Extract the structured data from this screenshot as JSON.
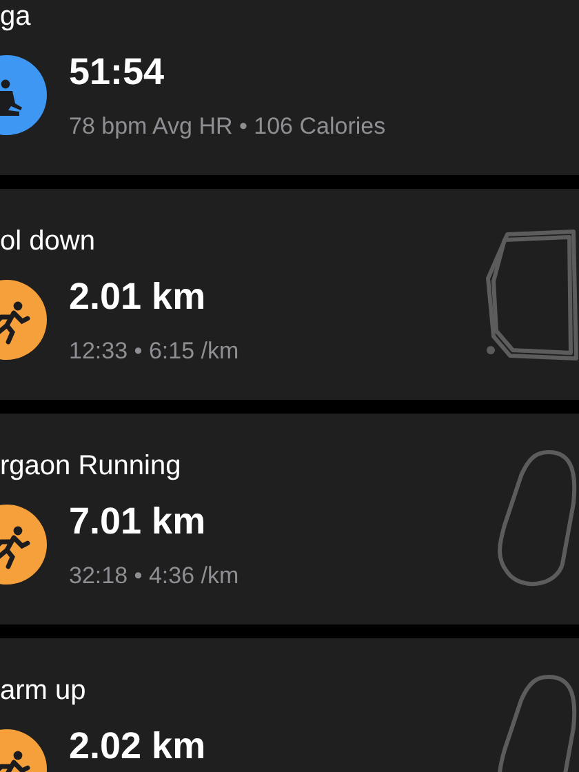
{
  "workouts": [
    {
      "title": "ga",
      "kind": "yoga",
      "value": "51:54",
      "detail": "78 bpm Avg HR • 106 Calories"
    },
    {
      "title": "ol down",
      "kind": "run",
      "value": "2.01 km",
      "detail": "12:33 • 6:15 /km",
      "route": {
        "kind": "square"
      }
    },
    {
      "title": "rgaon Running",
      "kind": "run",
      "value": "7.01 km",
      "detail": "32:18 • 4:36 /km",
      "route": {
        "kind": "oval"
      }
    },
    {
      "title": "arm up",
      "kind": "run",
      "value": "2.02 km",
      "route": {
        "kind": "oval"
      }
    }
  ]
}
